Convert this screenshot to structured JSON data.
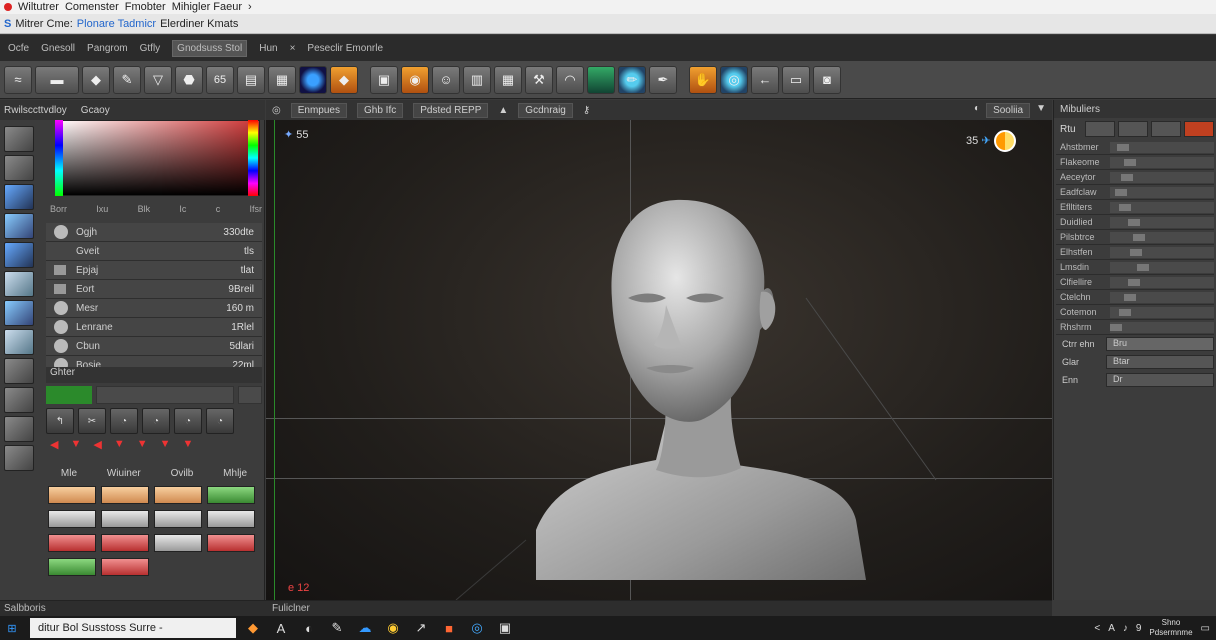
{
  "window": {
    "tabs": [
      "Wiltutrer",
      "Comenster",
      "Fmobter",
      "Mihigler Faeur"
    ],
    "address_label": "Mitrer Cme:",
    "address_highlight": "Plonare Tadmicr",
    "address_rest": "Elerdiner Kmats"
  },
  "menu": [
    "Ocfe",
    "Gnesoll",
    "Pangrom",
    "Gtfly",
    "Gnodsuss Stol",
    "Hun",
    "Peseclir Emonrle"
  ],
  "toolbar_icons": [
    "brush-stroke-icon",
    "clay-icon",
    "smooth-icon",
    "pen-icon",
    "triangle-icon",
    "shield-icon",
    "counter-icon",
    "cylinder-icon",
    "grid-icon",
    "sphere-blue-icon",
    "flame-icon",
    "display-icon",
    "lock-icon",
    "face-icon",
    "wireframe-icon",
    "chip-icon",
    "tool-icon",
    "curve-icon",
    "green-map-icon",
    "pencil-icon",
    "pen-nib-icon",
    "hand-icon",
    "globe-icon",
    "arrow-icon",
    "box-icon",
    "camera-icon"
  ],
  "toolbar_counter": "65",
  "left_panel": {
    "tabs": [
      "Rwilsccttvdloy",
      "Gcaoy"
    ],
    "picker_labels": [
      "Borr",
      "Ixu",
      "Blk",
      "Ic",
      "c",
      "Ifsr"
    ],
    "properties": [
      {
        "name": "Ogjh",
        "value": "330dte",
        "kind": "knob"
      },
      {
        "name": "Gveit",
        "value": "tls",
        "kind": "none"
      },
      {
        "name": "Epjaj",
        "value": "tlat",
        "kind": "sq"
      },
      {
        "name": "Eort",
        "value": "9Breil",
        "kind": "sq"
      },
      {
        "name": "Mesr",
        "value": "160 m",
        "kind": "knob"
      },
      {
        "name": "Lenrane",
        "value": "1Rlel",
        "kind": "knob"
      },
      {
        "name": "Cbun",
        "value": "5dlari",
        "kind": "knob"
      },
      {
        "name": "Bosie",
        "value": "22ml",
        "kind": "knob"
      }
    ],
    "other_header": "Ghter",
    "material_headers": [
      "Mle",
      "Wiuiner",
      "Ovilb",
      "Mhlje"
    ],
    "material_colors": [
      "o",
      "o",
      "o",
      "g",
      "w",
      "w",
      "w",
      "w",
      "r",
      "r",
      "w",
      "r",
      "g",
      "r"
    ]
  },
  "viewport": {
    "tabs": [
      "Enmpues",
      "Ghb Ifc",
      "Pdsted REPP",
      "Gcdnraig"
    ],
    "right_tab": "Sooliia",
    "frame_left": "55",
    "frame_right": "35",
    "indicator": "e 12"
  },
  "right_panel": {
    "title": "Mibuliers",
    "ctrl_label": "Rtu",
    "sliders": [
      {
        "name": "Ahstbmer",
        "pos": 0.08
      },
      {
        "name": "Flakeome",
        "pos": 0.15
      },
      {
        "name": "Aeceytor",
        "pos": 0.12
      },
      {
        "name": "Eadfclaw",
        "pos": 0.05
      },
      {
        "name": "Eflltiters",
        "pos": 0.1
      },
      {
        "name": "Duidlied",
        "pos": 0.2
      },
      {
        "name": "Pilsbtrce",
        "pos": 0.25
      },
      {
        "name": "Elhstfen",
        "pos": 0.22
      },
      {
        "name": "Lmsdin",
        "pos": 0.3
      },
      {
        "name": "Clfiellire",
        "pos": 0.2
      },
      {
        "name": "Ctelchn",
        "pos": 0.15
      },
      {
        "name": "Cotemon",
        "pos": 0.1
      },
      {
        "name": "Rhshrm",
        "pos": 0.0
      }
    ],
    "extra": [
      {
        "label": "Ctrr ehn",
        "value": "Bru"
      },
      {
        "label": "Glar",
        "value": "Btar"
      },
      {
        "label": "Enn",
        "value": "Dr"
      }
    ]
  },
  "status": {
    "left": "Salbboris",
    "right": "Fuliclner"
  },
  "taskbar": {
    "search": "ditur Bol Susstoss Surre -",
    "icons": [
      "flame-icon",
      "a-icon",
      "or-icon",
      "pen-icon",
      "cloud-icon",
      "chrome-icon",
      "arrow-icon",
      "tile-icon",
      "browser-icon",
      "app-icon"
    ],
    "tray": [
      "<",
      "A",
      "9"
    ],
    "clock_top": "Shno",
    "clock_bottom": "Pdsermnme"
  }
}
